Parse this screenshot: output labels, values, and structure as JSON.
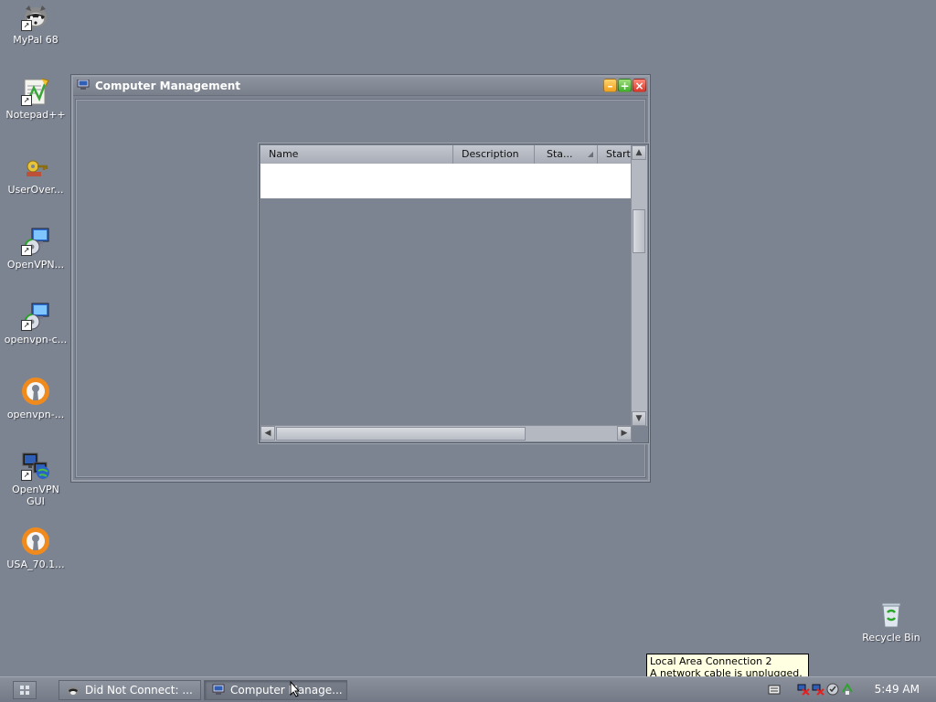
{
  "desktop": {
    "icons": [
      {
        "label": "MyPal 68",
        "icon": "raccoon-icon"
      },
      {
        "label": "Notepad++",
        "icon": "notepad-plus-plus-icon"
      },
      {
        "label": "UserOver...",
        "icon": "key-icon"
      },
      {
        "label": "OpenVPN...",
        "icon": "installer-icon"
      },
      {
        "label": "openvpn-c...",
        "icon": "installer-icon"
      },
      {
        "label": "openvpn-...",
        "icon": "openvpn-icon"
      },
      {
        "label": "OpenVPN\nGUI",
        "icon": "network-computer-icon"
      },
      {
        "label": "USA_70.1...",
        "icon": "openvpn-icon"
      }
    ],
    "recycle_bin": {
      "label": "Recycle Bin",
      "icon": "recycle-bin-icon"
    }
  },
  "window": {
    "title": "Computer Management",
    "buttons": {
      "minimize": "minimize-button",
      "maximize": "maximize-button",
      "close": "close-button"
    }
  },
  "listview": {
    "columns": [
      "Name",
      "Description",
      "Sta...",
      "Start"
    ]
  },
  "taskbar": {
    "buttons": [
      {
        "label": "Did Not Connect: ...",
        "active": false
      },
      {
        "label": "Computer Manage...",
        "active": true
      }
    ],
    "clock": "5:49 AM"
  },
  "tooltip": {
    "line1": "Local Area Connection 2",
    "line2": "A network cable is unplugged."
  },
  "colors": {
    "desktop": "#7d8491",
    "tooltip_bg": "#ffffe1"
  }
}
